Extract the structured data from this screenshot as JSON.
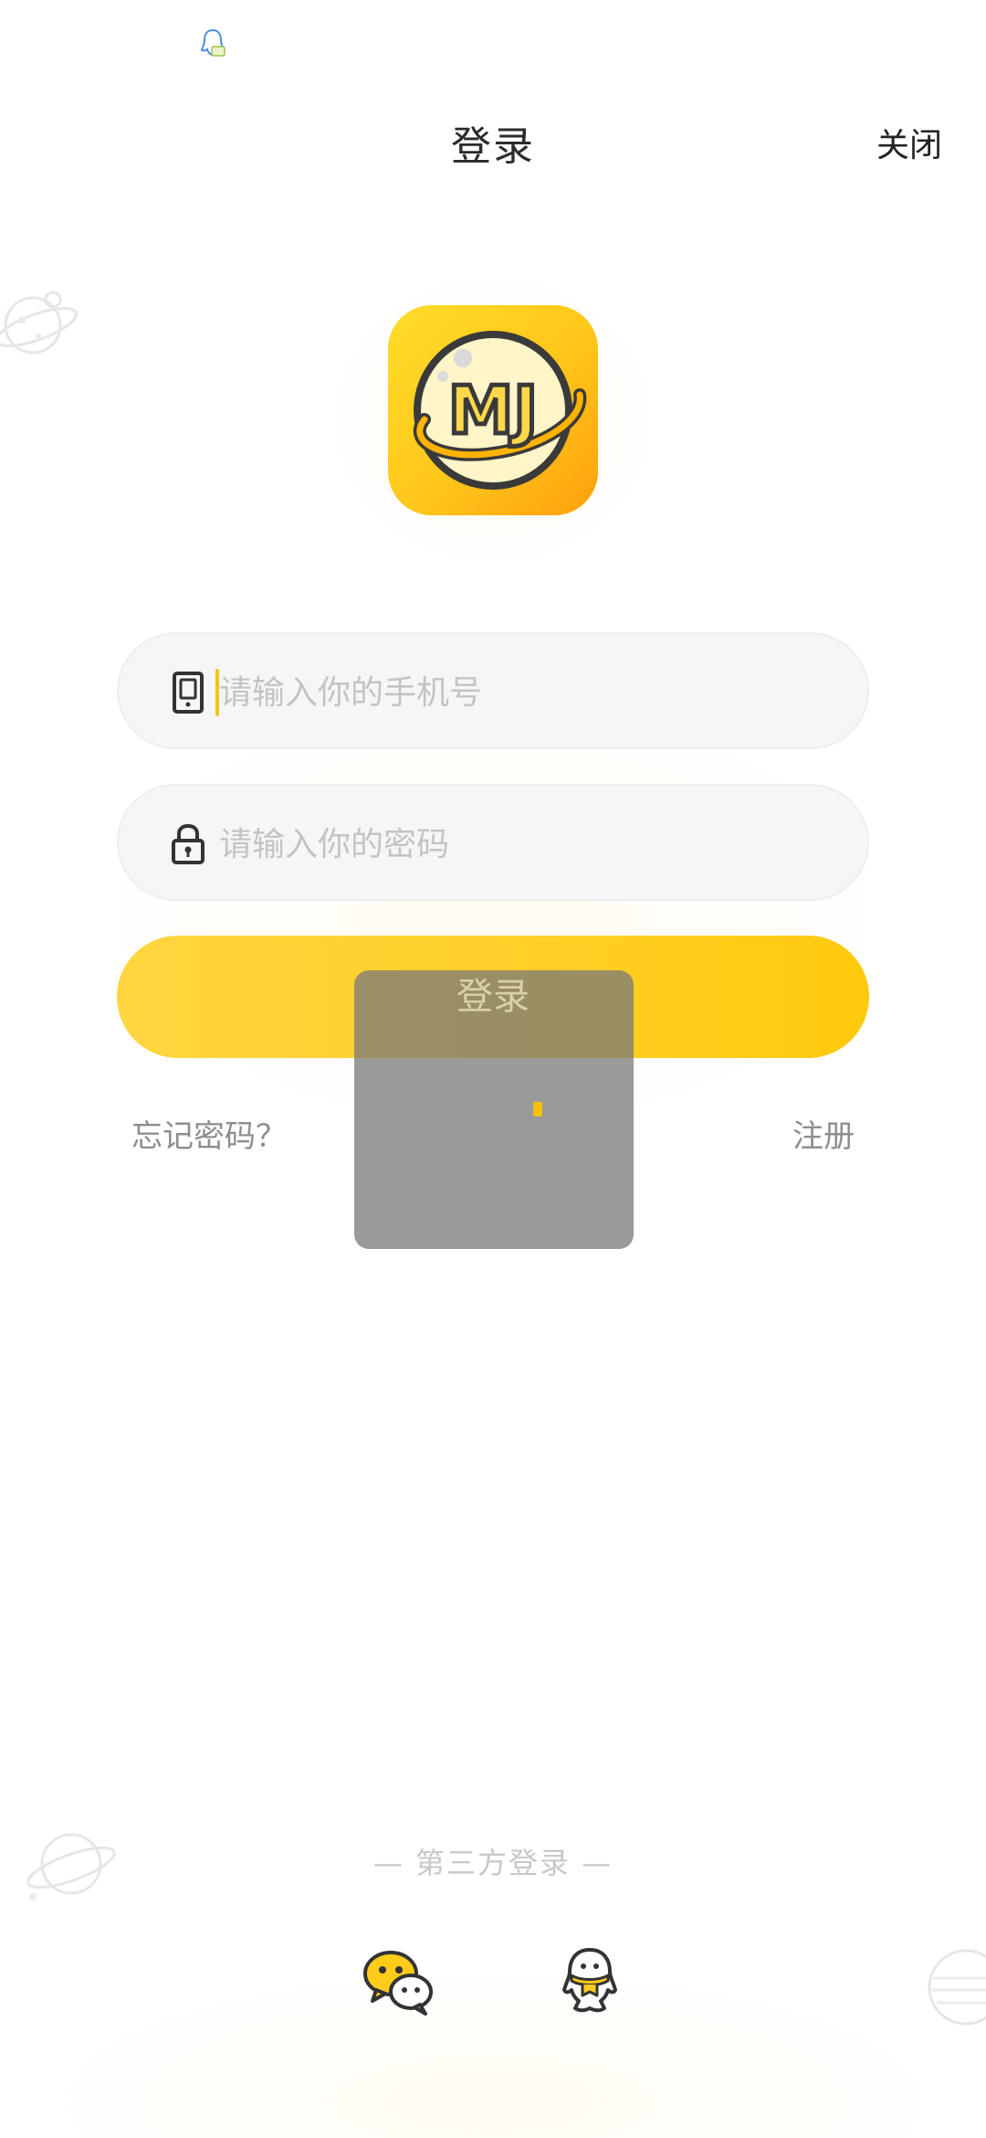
{
  "header": {
    "title": "登录",
    "close_label": "关闭"
  },
  "form": {
    "phone_placeholder": "请输入你的手机号",
    "password_placeholder": "请输入你的密码",
    "login_label": "登录"
  },
  "links": {
    "forgot_password": "忘记密码？",
    "register": "注册"
  },
  "third_party": {
    "label": "— 第三方登录 —",
    "providers": [
      "wechat-icon",
      "qq-icon"
    ]
  },
  "logo": {
    "text": "MJ"
  },
  "colors": {
    "accent": "#FFCC1A",
    "accent_orange": "#FFA010",
    "field_bg": "#F6F6F6",
    "muted_text": "#8E8E8E"
  }
}
